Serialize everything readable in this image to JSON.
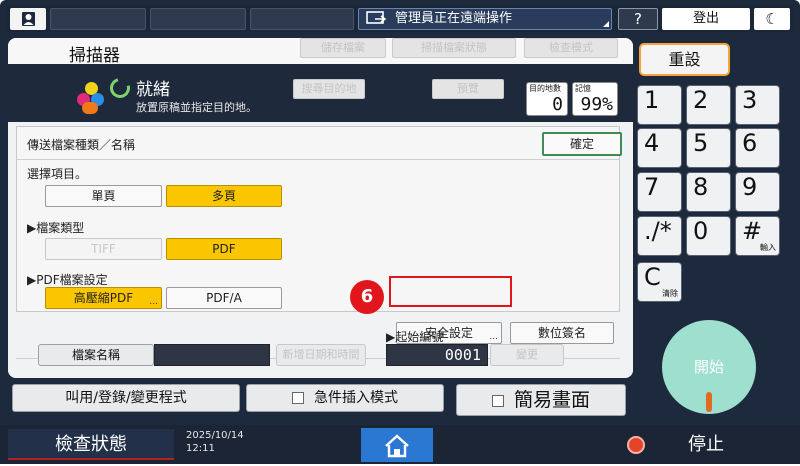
{
  "topbar": {
    "remote_text": "管理員正在遠端操作",
    "help_label": "?",
    "logout_label": "登出",
    "moon_label": "☾"
  },
  "app": {
    "title": "掃描器",
    "header_buttons": [
      "儲存檔案",
      "掃描檔案狀態",
      "檢查模式"
    ],
    "status": "就緒",
    "status_sub": "放置原稿並指定目的地。",
    "mid_buttons": [
      "搜尋目的地",
      "預覽"
    ],
    "dest_count_label": "目的地數",
    "dest_count": "0",
    "memory_label": "記憶",
    "memory_value": "99%"
  },
  "panel": {
    "title": "傳送檔案種類／名稱",
    "ok_label": "確定",
    "select_items_label": "選擇項目。",
    "page_options": [
      "單頁",
      "多頁"
    ],
    "file_type_label": "▶檔案類型",
    "file_types": [
      "TIFF",
      "PDF"
    ],
    "pdf_settings_label": "▶PDF檔案設定",
    "pdf_options": [
      "高壓縮PDF",
      "PDF/A"
    ],
    "security_label": "安全設定",
    "signature_label": "數位簽名",
    "step_badge": "6",
    "file_name_label": "檔案名稱",
    "add_datetime_label": "新增日期和時間",
    "start_number_label": "▶起始編號",
    "start_number": "0001",
    "change_label": "變更"
  },
  "lower": {
    "program_label": "叫用/登錄/變更程式",
    "urgent_label": "急件插入模式",
    "simple_label": "簡易畫面"
  },
  "keypad": {
    "reset_label": "重設",
    "keys": [
      {
        "n": "1",
        "s": ""
      },
      {
        "n": "2",
        "s": ""
      },
      {
        "n": "3",
        "s": ""
      },
      {
        "n": "4",
        "s": ""
      },
      {
        "n": "5",
        "s": ""
      },
      {
        "n": "6",
        "s": ""
      },
      {
        "n": "7",
        "s": ""
      },
      {
        "n": "8",
        "s": ""
      },
      {
        "n": "9",
        "s": ""
      },
      {
        "n": "./*",
        "s": ""
      },
      {
        "n": "0",
        "s": ""
      },
      {
        "n": "#",
        "s": "輸入"
      },
      {
        "n": "C",
        "s": "清除"
      }
    ],
    "start_label": "開始"
  },
  "bottombar": {
    "check_status_label": "檢查狀態",
    "date": "2025/10/14",
    "time": "12:11",
    "stop_label": "停止"
  },
  "colors": {
    "selected": "#f9c600",
    "highlight": "#e0161c",
    "ok_border": "#3e8c58",
    "reset_border": "#f6a33a",
    "start": "#9fdfce",
    "home": "#2a78d2"
  }
}
